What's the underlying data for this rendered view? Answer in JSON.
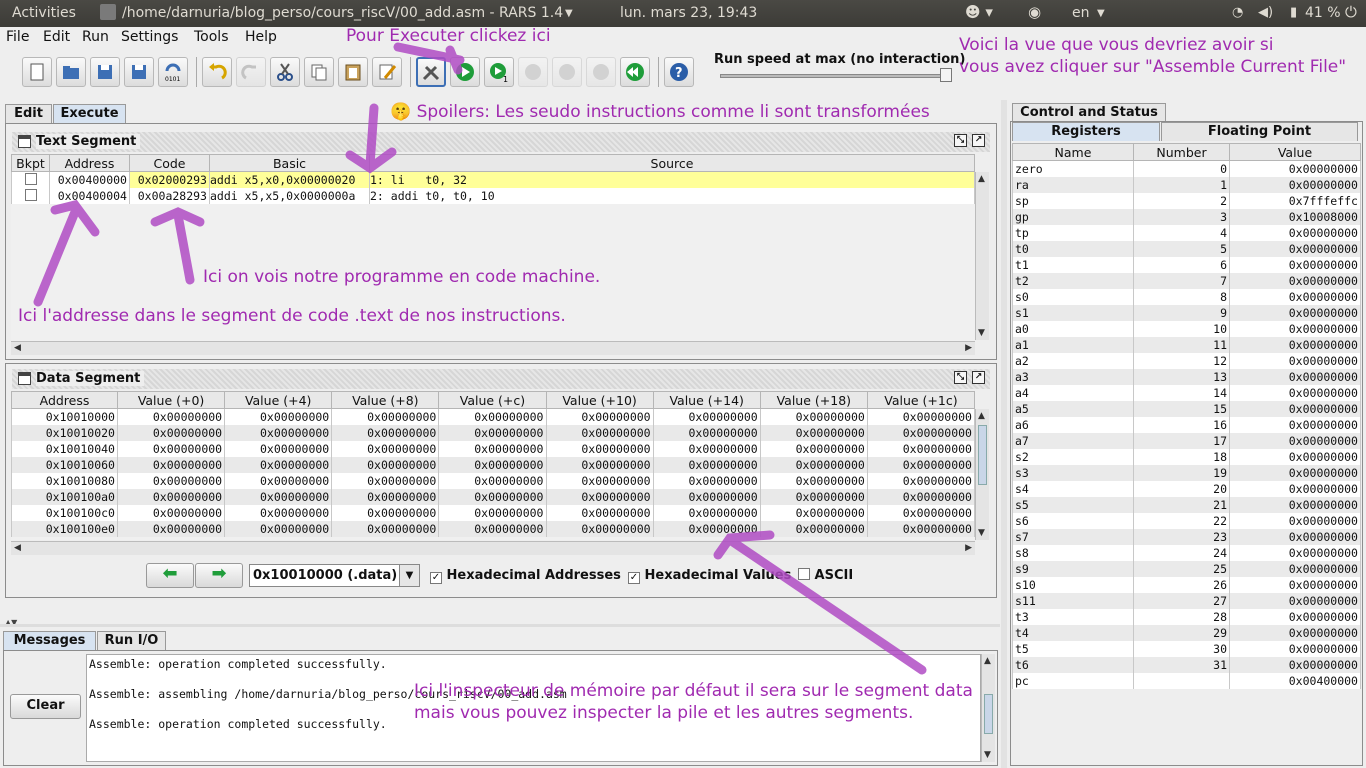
{
  "topbar": {
    "activities": "Activities",
    "window_title": "/home/darnuria/blog_perso/cours_riscV/00_add.asm  - RARS 1.4",
    "datetime": "lun. mars 23, 19:43",
    "lang": "en",
    "battery": "41 %"
  },
  "menu": {
    "file": "File",
    "edit": "Edit",
    "run": "Run",
    "settings": "Settings",
    "tools": "Tools",
    "help": "Help"
  },
  "speed": {
    "label": "Run speed at max (no interaction)",
    "value": 1.0
  },
  "tabs": {
    "edit": "Edit",
    "execute": "Execute"
  },
  "text_segment": {
    "title": "Text Segment",
    "columns": [
      "Bkpt",
      "Address",
      "Code",
      "Basic",
      "Source"
    ],
    "rows": [
      {
        "address": "0x00400000",
        "code": "0x02000293",
        "basic": "addi x5,x0,0x00000020",
        "source": "1: li   t0, 32"
      },
      {
        "address": "0x00400004",
        "code": "0x00a28293",
        "basic": "addi x5,x5,0x0000000a",
        "source": "2: addi t0, t0, 10"
      }
    ]
  },
  "data_segment": {
    "title": "Data Segment",
    "columns": [
      "Address",
      "Value (+0)",
      "Value (+4)",
      "Value (+8)",
      "Value (+c)",
      "Value (+10)",
      "Value (+14)",
      "Value (+18)",
      "Value (+1c)"
    ],
    "rows": [
      [
        "0x10010000",
        "0x00000000",
        "0x00000000",
        "0x00000000",
        "0x00000000",
        "0x00000000",
        "0x00000000",
        "0x00000000",
        "0x00000000"
      ],
      [
        "0x10010020",
        "0x00000000",
        "0x00000000",
        "0x00000000",
        "0x00000000",
        "0x00000000",
        "0x00000000",
        "0x00000000",
        "0x00000000"
      ],
      [
        "0x10010040",
        "0x00000000",
        "0x00000000",
        "0x00000000",
        "0x00000000",
        "0x00000000",
        "0x00000000",
        "0x00000000",
        "0x00000000"
      ],
      [
        "0x10010060",
        "0x00000000",
        "0x00000000",
        "0x00000000",
        "0x00000000",
        "0x00000000",
        "0x00000000",
        "0x00000000",
        "0x00000000"
      ],
      [
        "0x10010080",
        "0x00000000",
        "0x00000000",
        "0x00000000",
        "0x00000000",
        "0x00000000",
        "0x00000000",
        "0x00000000",
        "0x00000000"
      ],
      [
        "0x100100a0",
        "0x00000000",
        "0x00000000",
        "0x00000000",
        "0x00000000",
        "0x00000000",
        "0x00000000",
        "0x00000000",
        "0x00000000"
      ],
      [
        "0x100100c0",
        "0x00000000",
        "0x00000000",
        "0x00000000",
        "0x00000000",
        "0x00000000",
        "0x00000000",
        "0x00000000",
        "0x00000000"
      ],
      [
        "0x100100e0",
        "0x00000000",
        "0x00000000",
        "0x00000000",
        "0x00000000",
        "0x00000000",
        "0x00000000",
        "0x00000000",
        "0x00000000"
      ]
    ],
    "segment_select": "0x10010000 (.data)",
    "hex_addresses": "Hexadecimal Addresses",
    "hex_values": "Hexadecimal Values",
    "ascii": "ASCII"
  },
  "messages": {
    "tab_messages": "Messages",
    "tab_runio": "Run I/O",
    "clear": "Clear",
    "lines": [
      "Assemble: operation completed successfully.",
      "Assemble: assembling /home/darnuria/blog_perso/cours_riscV/00_add.asm",
      "Assemble: operation completed successfully."
    ]
  },
  "registers": {
    "tab_control": "Control and Status",
    "tab_registers": "Registers",
    "tab_fp": "Floating Point",
    "columns": [
      "Name",
      "Number",
      "Value"
    ],
    "rows": [
      [
        "zero",
        "0",
        "0x00000000"
      ],
      [
        "ra",
        "1",
        "0x00000000"
      ],
      [
        "sp",
        "2",
        "0x7fffeffc"
      ],
      [
        "gp",
        "3",
        "0x10008000"
      ],
      [
        "tp",
        "4",
        "0x00000000"
      ],
      [
        "t0",
        "5",
        "0x00000000"
      ],
      [
        "t1",
        "6",
        "0x00000000"
      ],
      [
        "t2",
        "7",
        "0x00000000"
      ],
      [
        "s0",
        "8",
        "0x00000000"
      ],
      [
        "s1",
        "9",
        "0x00000000"
      ],
      [
        "a0",
        "10",
        "0x00000000"
      ],
      [
        "a1",
        "11",
        "0x00000000"
      ],
      [
        "a2",
        "12",
        "0x00000000"
      ],
      [
        "a3",
        "13",
        "0x00000000"
      ],
      [
        "a4",
        "14",
        "0x00000000"
      ],
      [
        "a5",
        "15",
        "0x00000000"
      ],
      [
        "a6",
        "16",
        "0x00000000"
      ],
      [
        "a7",
        "17",
        "0x00000000"
      ],
      [
        "s2",
        "18",
        "0x00000000"
      ],
      [
        "s3",
        "19",
        "0x00000000"
      ],
      [
        "s4",
        "20",
        "0x00000000"
      ],
      [
        "s5",
        "21",
        "0x00000000"
      ],
      [
        "s6",
        "22",
        "0x00000000"
      ],
      [
        "s7",
        "23",
        "0x00000000"
      ],
      [
        "s8",
        "24",
        "0x00000000"
      ],
      [
        "s9",
        "25",
        "0x00000000"
      ],
      [
        "s10",
        "26",
        "0x00000000"
      ],
      [
        "s11",
        "27",
        "0x00000000"
      ],
      [
        "t3",
        "28",
        "0x00000000"
      ],
      [
        "t4",
        "29",
        "0x00000000"
      ],
      [
        "t5",
        "30",
        "0x00000000"
      ],
      [
        "t6",
        "31",
        "0x00000000"
      ],
      [
        "pc",
        "",
        "0x00400000"
      ]
    ]
  },
  "annotations": {
    "execute": "Pour Executer clickez ici",
    "view1": "Voici la vue que vous devriez avoir si",
    "view2": "vous avez cliquer sur \"Assemble Current File\"",
    "spoilers": "🤫 Spoilers: Les seudo instructions comme li sont transformées",
    "machine": "Ici on vois notre programme en code machine.",
    "address": "Ici l'addresse dans le segment de code .text de nos instructions.",
    "inspect1": "Ici l'inspecteur de mémoire par défaut il sera sur le segment data",
    "inspect2": "mais vous pouvez inspecter la pile et les autres segments."
  },
  "colors": {
    "annotation": "#a02ab0",
    "highlight_row": "#ffff99",
    "selected_tab": "#d7e3f1"
  }
}
